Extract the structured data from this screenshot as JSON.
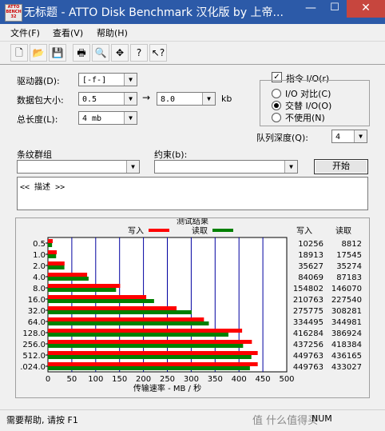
{
  "window": {
    "title": "无标题 - ATTO Disk Benchmark  汉化版 by 上帝...",
    "icon_text": "ATTO BENCH 32",
    "min_glyph": "—",
    "max_glyph": "☐",
    "close_glyph": "✕"
  },
  "menu": [
    "文件(F)",
    "查看(V)",
    "帮助(H)"
  ],
  "toolbar_icons": [
    "new-file-icon",
    "open-folder-icon",
    "save-icon",
    "print-icon",
    "print-preview-icon",
    "move-icon",
    "help-icon",
    "context-help-icon"
  ],
  "toolbar_glyphs": [
    "🗋",
    "📂",
    "💾",
    "🖶",
    "🔍",
    "✥",
    "?",
    "↖?"
  ],
  "form": {
    "drive_label": "驱动器(D):",
    "drive_value": "[-f-]",
    "packet_label": "数据包大小:",
    "packet_from": "0.5",
    "arrow": "→",
    "packet_to": "8.0",
    "packet_unit": "kb",
    "length_label": "总长度(L):",
    "length_value": "4 mb",
    "stripe_label": "条纹群组",
    "constraint_label": "约束(b):",
    "start_label": "开始",
    "desc_value": "<< 描述 >>",
    "dropdown_arrow": "▼"
  },
  "options": {
    "direct_io_label": "指令 I/O(r)",
    "direct_io_checked": true,
    "check_mark": "✓",
    "io_compare": "I/O 对比(C)",
    "overlapped_io": "交替 I/O(O)",
    "neither": "不使用(N)",
    "selected": "overlapped_io",
    "queue_label": "队列深度(Q):",
    "queue_value": "4"
  },
  "results": {
    "title": "测试结果",
    "legend_write": "写入",
    "legend_read": "读取",
    "col_write": "写入",
    "col_read": "读取",
    "write_color": "#ff0000",
    "read_color": "#008000",
    "grid_color": "#0000a0"
  },
  "chart_data": {
    "type": "bar",
    "orientation": "horizontal",
    "title": "测试结果",
    "xlabel": "传输速率 - MB / 秒",
    "xlim": [
      0,
      500
    ],
    "xticks": [
      0,
      50,
      100,
      150,
      200,
      250,
      300,
      350,
      400,
      450,
      500
    ],
    "categories": [
      "0.5",
      "1.0",
      "2.0",
      "4.0",
      "8.0",
      "16.0",
      "32.0",
      "64.0",
      "128.0",
      "256.0",
      "512.0",
      "1024.0"
    ],
    "category_labels": [
      "0.5",
      "1.0",
      "2.0",
      "4.0",
      "8.0",
      "16.0",
      "32.0",
      "64.0",
      "128.0",
      "256.0",
      "512.0",
      ".024.0"
    ],
    "series": [
      {
        "name": "写入",
        "color": "#ff0000",
        "values": [
          10256,
          18913,
          35627,
          84069,
          154802,
          210763,
          275775,
          334495,
          416284,
          437256,
          449763,
          449763
        ]
      },
      {
        "name": "读取",
        "color": "#008000",
        "values": [
          8812,
          17545,
          35274,
          87183,
          146070,
          227540,
          308281,
          344981,
          386924,
          418384,
          436165,
          433027
        ]
      }
    ],
    "legend": "top"
  },
  "status": {
    "help_text": "需要帮助, 请按 F1",
    "num_text": "NUM",
    "watermark": "值 什么值得买"
  }
}
